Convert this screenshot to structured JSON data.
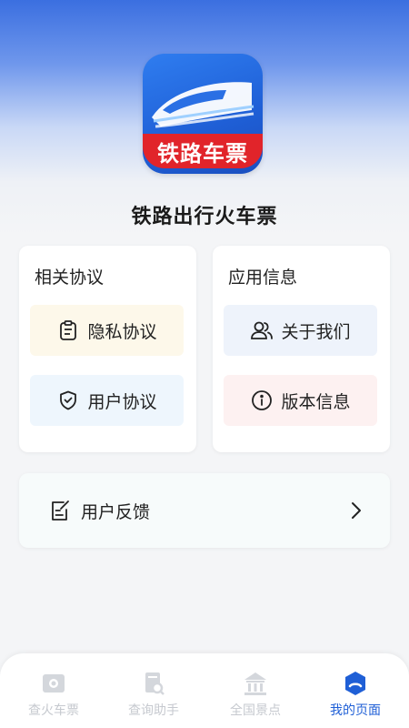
{
  "app": {
    "logo_text": "铁路车票",
    "name": "铁路出行火车票"
  },
  "agreements": {
    "title": "相关协议",
    "privacy_label": "隐私协议",
    "user_label": "用户协议"
  },
  "app_info": {
    "title": "应用信息",
    "about_label": "关于我们",
    "version_label": "版本信息"
  },
  "feedback": {
    "label": "用户反馈"
  },
  "tabbar": {
    "tabs": [
      {
        "label": "查火车票",
        "icon": "ticket-icon"
      },
      {
        "label": "查询助手",
        "icon": "search-doc-icon"
      },
      {
        "label": "全国景点",
        "icon": "landmark-icon"
      },
      {
        "label": "我的页面",
        "icon": "profile-icon",
        "active": true
      }
    ]
  },
  "colors": {
    "accent": "#1f5fd6",
    "logo_red": "#e1242a",
    "inactive_tab": "#c6c9cf"
  }
}
